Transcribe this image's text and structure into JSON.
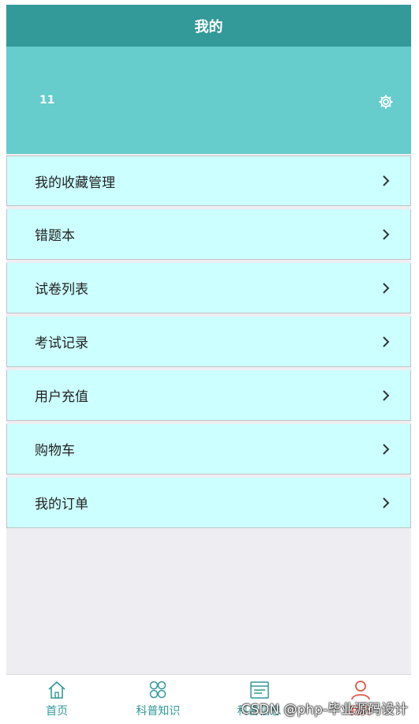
{
  "header": {
    "title": "我的"
  },
  "profile": {
    "username": "11",
    "settings_icon": "gear-icon"
  },
  "menu": {
    "items": [
      {
        "label": "我的收藏管理",
        "icon": "chevron-right-icon"
      },
      {
        "label": "错题本",
        "icon": "chevron-right-icon"
      },
      {
        "label": "试卷列表",
        "icon": "chevron-right-icon"
      },
      {
        "label": "考试记录",
        "icon": "chevron-right-icon"
      },
      {
        "label": "用户充值",
        "icon": "chevron-right-icon"
      },
      {
        "label": "购物车",
        "icon": "chevron-right-icon"
      },
      {
        "label": "我的订单",
        "icon": "chevron-right-icon"
      }
    ]
  },
  "tabbar": {
    "tabs": [
      {
        "label": "首页",
        "icon": "home-icon"
      },
      {
        "label": "科普知识",
        "icon": "grid-icon"
      },
      {
        "label": "科普信息",
        "icon": "news-icon"
      },
      {
        "label": "我的",
        "icon": "user-icon"
      }
    ]
  },
  "watermark": "CSDN @php-毕业源码设计",
  "colors": {
    "title_bar": "#339999",
    "profile_bg": "#66cccc",
    "menu_bg": "#ccffff",
    "page_bg": "#eeeef2",
    "tab_active": "#e0584a",
    "tab_inactive": "#339999"
  }
}
